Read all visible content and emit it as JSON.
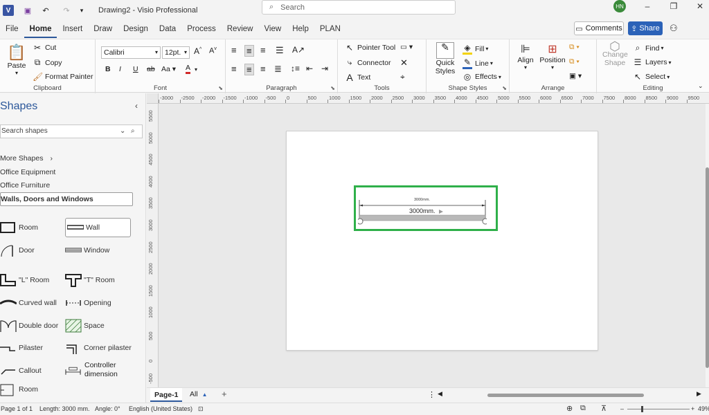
{
  "app": {
    "title": "Drawing2  -  Visio Professional",
    "search_placeholder": "Search",
    "user_initials": "HN"
  },
  "menu": {
    "tabs": [
      "File",
      "Home",
      "Insert",
      "Draw",
      "Design",
      "Data",
      "Process",
      "Review",
      "View",
      "Help",
      "PLAN"
    ],
    "comments": "Comments",
    "share": "Share"
  },
  "ribbon": {
    "clipboard": {
      "label": "Clipboard",
      "paste": "Paste",
      "cut": "Cut",
      "copy": "Copy",
      "format_painter": "Format Painter"
    },
    "font": {
      "label": "Font",
      "family": "Calibri",
      "size": "12pt."
    },
    "paragraph": {
      "label": "Paragraph"
    },
    "tools": {
      "label": "Tools",
      "pointer": "Pointer Tool",
      "connector": "Connector",
      "text": "Text"
    },
    "shape_styles": {
      "label": "Shape Styles",
      "quick_styles": "Quick Styles",
      "fill": "Fill",
      "line": "Line",
      "effects": "Effects"
    },
    "arrange": {
      "label": "Arrange",
      "align": "Align",
      "position": "Position"
    },
    "editing": {
      "label": "Editing",
      "change_shape": "Change Shape",
      "find": "Find",
      "layers": "Layers",
      "select": "Select"
    }
  },
  "shapes_pane": {
    "title": "Shapes",
    "search_placeholder": "Search shapes",
    "more_shapes": "More Shapes",
    "stencils": [
      "Office Equipment",
      "Office Furniture",
      "Walls, Doors and Windows"
    ],
    "items": [
      "Room",
      "Wall",
      "Door",
      "Window",
      "\"L\" Room",
      "\"T\" Room",
      "Curved wall",
      "Opening",
      "Double door",
      "Space",
      "Pilaster",
      "Corner pilaster",
      "Callout",
      "Controller dimension",
      "Room"
    ]
  },
  "ruler": {
    "h_ticks": [
      "-3000",
      "-2500",
      "-2000",
      "-1500",
      "-1000",
      "-500",
      "0",
      "500",
      "1000",
      "1500",
      "2000",
      "2500",
      "3000",
      "3500",
      "4000",
      "4500",
      "5000",
      "5500",
      "6000",
      "6500",
      "7000",
      "7500",
      "8000",
      "8500",
      "9000",
      "9500"
    ],
    "v_ticks": [
      "5500",
      "5000",
      "4500",
      "4000",
      "3500",
      "3000",
      "2500",
      "2000",
      "1500",
      "1000",
      "500",
      "0",
      "-500"
    ]
  },
  "drawing": {
    "dim_small": "3000mm.",
    "dim_big": "3000mm.",
    "highlight_color": "#2fb04a"
  },
  "pages": {
    "current": "Page-1",
    "all": "All"
  },
  "status": {
    "page": "Page 1 of 1",
    "length": "Length: 3000 mm.",
    "angle": "Angle: 0°",
    "language": "English (United States)",
    "zoom": "49%"
  }
}
